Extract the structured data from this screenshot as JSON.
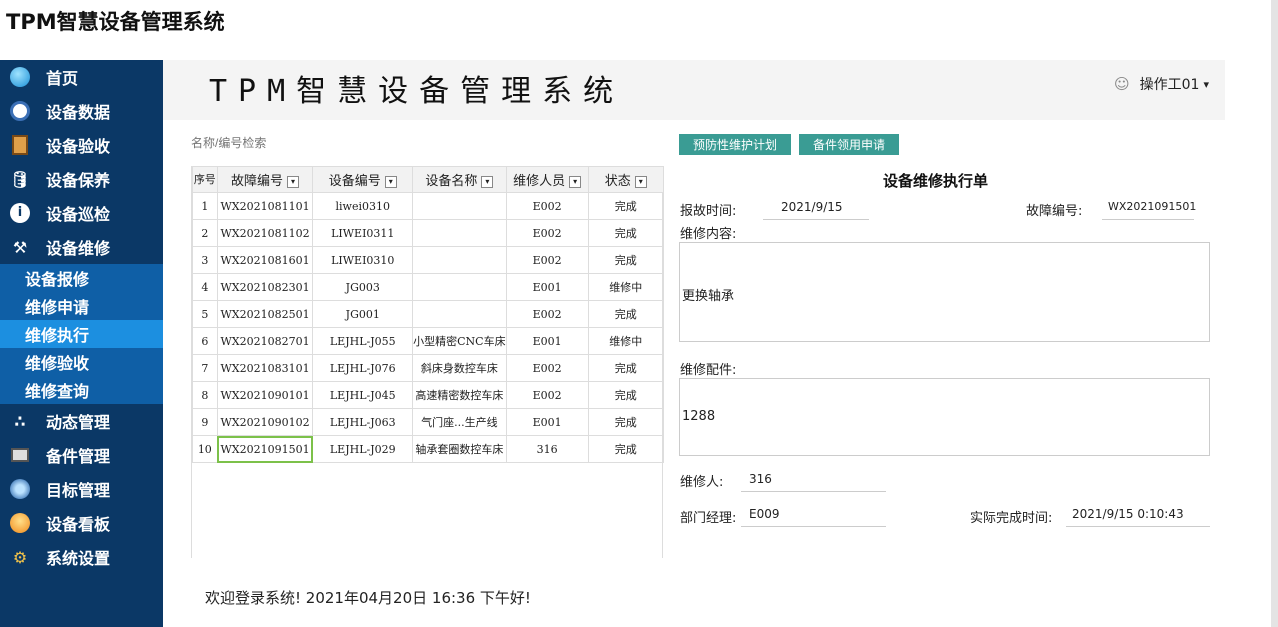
{
  "app": {
    "title": "TPM智慧设备管理系统"
  },
  "sidebar": {
    "items": [
      {
        "label": "首页",
        "icon": "home-icon"
      },
      {
        "label": "设备数据",
        "icon": "monitor-icon"
      },
      {
        "label": "设备验收",
        "icon": "clipboard-icon"
      },
      {
        "label": "设备保养",
        "icon": "oil-can-icon"
      },
      {
        "label": "设备巡检",
        "icon": "info-icon"
      },
      {
        "label": "设备维修",
        "icon": "tools-icon"
      }
    ],
    "submenu": [
      {
        "label": "设备报修"
      },
      {
        "label": "维修申请"
      },
      {
        "label": "维修执行"
      },
      {
        "label": "维修验收"
      },
      {
        "label": "维修查询"
      }
    ],
    "items2": [
      {
        "label": "动态管理",
        "icon": "network-icon"
      },
      {
        "label": "备件管理",
        "icon": "keyboard-icon"
      },
      {
        "label": "目标管理",
        "icon": "target-icon"
      },
      {
        "label": "设备看板",
        "icon": "board-icon"
      },
      {
        "label": "系统设置",
        "icon": "gear-icon"
      }
    ],
    "active_sub": "维修执行"
  },
  "banner": {
    "title": "TPM智慧设备管理系统",
    "user": "操作工01",
    "caret": "▾"
  },
  "search": {
    "placeholder": "名称/编号检索"
  },
  "buttons": {
    "plan": "预防性维护计划",
    "parts": "备件领用申请"
  },
  "table": {
    "headers": [
      "序号",
      "故障编号",
      "设备编号",
      "设备名称",
      "维修人员",
      "状态"
    ],
    "rows": [
      [
        "1",
        "WX2021081101",
        "liwei0310",
        "",
        "E002",
        "完成"
      ],
      [
        "2",
        "WX2021081102",
        "LIWEI0311",
        "",
        "E002",
        "完成"
      ],
      [
        "3",
        "WX2021081601",
        "LIWEI0310",
        "",
        "E002",
        "完成"
      ],
      [
        "4",
        "WX2021082301",
        "JG003",
        "",
        "E001",
        "维修中"
      ],
      [
        "5",
        "WX2021082501",
        "JG001",
        "",
        "E002",
        "完成"
      ],
      [
        "6",
        "WX2021082701",
        "LEJHL-J055",
        "小型精密CNC车床",
        "E001",
        "维修中"
      ],
      [
        "7",
        "WX2021083101",
        "LEJHL-J076",
        "斜床身数控车床",
        "E002",
        "完成"
      ],
      [
        "8",
        "WX2021090101",
        "LEJHL-J045",
        "高速精密数控车床",
        "E002",
        "完成"
      ],
      [
        "9",
        "WX2021090102",
        "LEJHL-J063",
        "气门座...生产线",
        "E001",
        "完成"
      ],
      [
        "10",
        "WX2021091501",
        "LEJHL-J029",
        "轴承套圈数控车床",
        "316",
        "完成"
      ]
    ]
  },
  "form": {
    "title": "设备维修执行单",
    "report_time_label": "报故时间:",
    "report_time": "2021/9/15",
    "fault_no_label": "故障编号:",
    "fault_no": "WX2021091501",
    "content_label": "维修内容:",
    "content": "更换轴承",
    "parts_label": "维修配件:",
    "parts": "1288",
    "repairer_label": "维修人:",
    "repairer": "316",
    "manager_label": "部门经理:",
    "manager": "E009",
    "finish_label": "实际完成时间:",
    "finish": "2021/9/15 0:10:43"
  },
  "footer": {
    "welcome": "欢迎登录系统!  2021年04月20日 16:36 下午好!"
  },
  "colors": {
    "sidebar": "#0b3866",
    "submenu": "#0f5fa6",
    "active": "#1c8fe0",
    "button": "#3a9c94",
    "selected_cell": "#7cc14a"
  }
}
